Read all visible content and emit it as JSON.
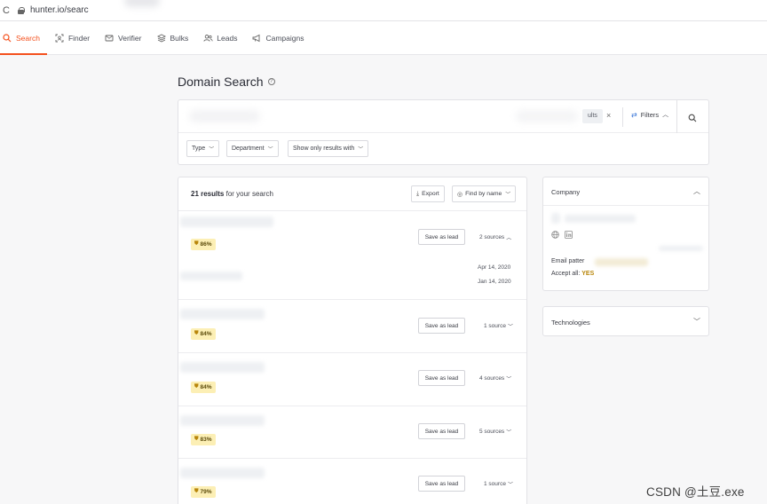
{
  "browser": {
    "url": "hunter.io/searc"
  },
  "nav": {
    "items": [
      {
        "label": "Search",
        "icon": "search-icon"
      },
      {
        "label": "Finder",
        "icon": "finder-icon"
      },
      {
        "label": "Verifier",
        "icon": "verifier-icon"
      },
      {
        "label": "Bulks",
        "icon": "layers-icon"
      },
      {
        "label": "Leads",
        "icon": "users-icon"
      },
      {
        "label": "Campaigns",
        "icon": "megaphone-icon"
      }
    ],
    "active": "Search"
  },
  "page": {
    "title": "Domain Search"
  },
  "search": {
    "results_pill": "ults",
    "filters_label": "Filters",
    "dropdowns": [
      "Type",
      "Department",
      "Show only results with"
    ]
  },
  "results": {
    "count": "21 results",
    "count_suffix": "for your search",
    "export_label": "Export",
    "find_label": "Find by name",
    "rows": [
      {
        "score": "86%",
        "save": "Save as lead",
        "sources": "2 sources",
        "expanded": true,
        "dates": [
          "Apr 14, 2020",
          "Jan 14, 2020"
        ]
      },
      {
        "score": "84%",
        "save": "Save as lead",
        "sources": "1 source",
        "expanded": false
      },
      {
        "score": "84%",
        "save": "Save as lead",
        "sources": "4 sources",
        "expanded": false
      },
      {
        "score": "83%",
        "save": "Save as lead",
        "sources": "5 sources",
        "expanded": false
      },
      {
        "score": "79%",
        "save": "Save as lead",
        "sources": "1 source",
        "expanded": false
      }
    ]
  },
  "company": {
    "title": "Company",
    "email_pattern_label": "Email patter",
    "accept_all_label": "Accept all:",
    "accept_all_value": "YES"
  },
  "technologies": {
    "title": "Technologies"
  },
  "watermark": "CSDN @土豆.exe",
  "colors": {
    "accent": "#f4511e",
    "badge_bg": "#fcefb5",
    "link_blue": "#2f6fd6"
  }
}
